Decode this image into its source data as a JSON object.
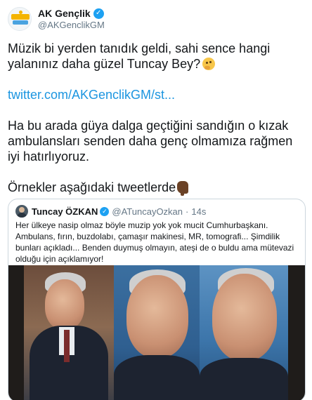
{
  "account": {
    "display_name": "AK Gençlik",
    "handle": "@AKGenclikGM",
    "verified_icon": "verified-badge-icon",
    "avatar_icon": "ak-genclik-logo-icon"
  },
  "tweet": {
    "paragraph1": "Müzik bi yerden tanıdık geldi, sahi sence hangi yalanınız daha güzel Tuncay Bey?",
    "paragraph1_emoji": "thinking-face-emoji",
    "link": "twitter.com/AKGenclikGM/st...",
    "paragraph3": "Ha bu arada güya dalga geçtiğini sandığın o kızak ambulansları senden daha genç olmamıza rağmen iyi hatırlıyoruz.",
    "paragraph4": "Örnekler aşağıdaki tweetlerde",
    "paragraph4_emoji": "pointing-down-emoji"
  },
  "quoted": {
    "display_name": "Tuncay ÖZKAN",
    "handle": "@ATuncayOzkan",
    "separator": "·",
    "time": "14s",
    "text": "Her ülkeye nasip olmaz böyle muzip yok yok mucit Cumhurbaşkanı. Ambulans, fırın, buzdolabı, çamaşır makinesi, MR, tomografi... Şimdilik bunları açıkladı... Benden duymuş olmayın, ateşi de o buldu ama mütevazi olduğu için açıklamıyor!"
  },
  "colors": {
    "link": "#1b95e0",
    "text": "#14171a",
    "secondary": "#657786",
    "border": "#ccd6dd",
    "verified": "#1da1f2"
  }
}
